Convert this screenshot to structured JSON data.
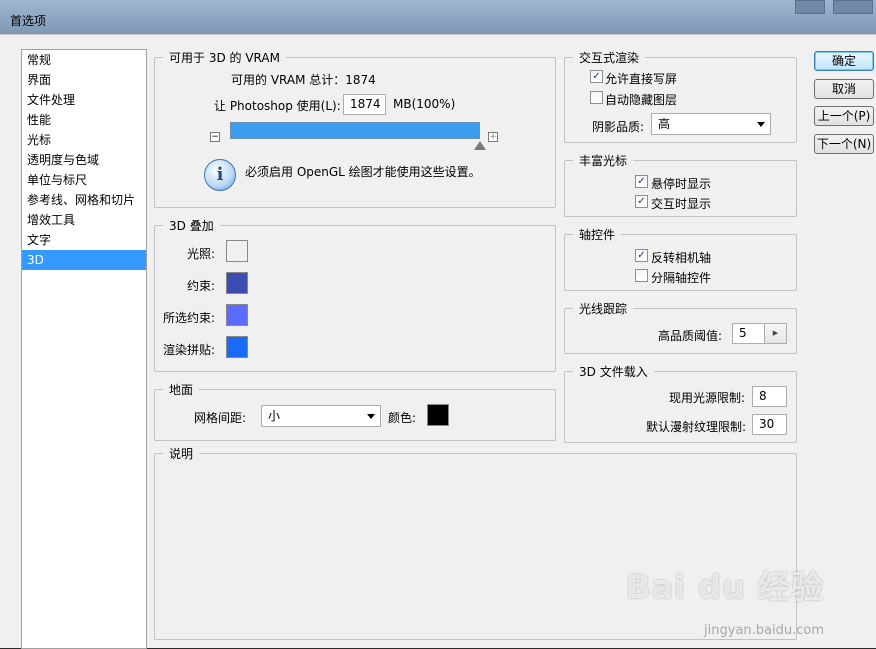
{
  "window": {
    "title": "首选项"
  },
  "sidebar": {
    "items": [
      {
        "label": "常规"
      },
      {
        "label": "界面"
      },
      {
        "label": "文件处理"
      },
      {
        "label": "性能"
      },
      {
        "label": "光标"
      },
      {
        "label": "透明度与色域"
      },
      {
        "label": "单位与标尺"
      },
      {
        "label": "参考线、网格和切片"
      },
      {
        "label": "增效工具"
      },
      {
        "label": "文字"
      },
      {
        "label": "3D"
      }
    ],
    "selected": "3D"
  },
  "vram": {
    "legend": "可用于 3D 的 VRAM",
    "total_text": "可用的 VRAM 总计：1874",
    "use_label": "让 Photoshop 使用(L):",
    "use_value": "1874",
    "unit_text": "MB(100%)",
    "slider_fraction": 1.0,
    "slider_min_icon": "−",
    "slider_max_icon": "+",
    "info_text": "必须启用 OpenGL 绘图才能使用这些设置。"
  },
  "overlay": {
    "legend": "3D 叠加",
    "rows": [
      {
        "label": "光照:",
        "color": "#f0f0f0"
      },
      {
        "label": "约束:",
        "color": "#3d4cb0"
      },
      {
        "label": "所选约束:",
        "color": "#5c6bff"
      },
      {
        "label": "渲染拼贴:",
        "color": "#1a6af5"
      }
    ]
  },
  "ground": {
    "legend": "地面",
    "grid_label": "网格间距:",
    "grid_value": "小",
    "color_label": "颜色:",
    "color": "#000000"
  },
  "description": {
    "legend": "说明"
  },
  "interactive": {
    "legend": "交互式渲染",
    "allow_direct_write": "允许直接写屏",
    "auto_hide_layers": "自动隐藏图层",
    "shadow_quality_label": "阴影品质:",
    "shadow_quality_value": "高"
  },
  "rich_cursor": {
    "legend": "丰富光标",
    "show_on_hover": "悬停时显示",
    "show_on_interact": "交互时显示"
  },
  "axis": {
    "legend": "轴控件",
    "invert_camera": "反转相机轴",
    "separate_axis": "分隔轴控件"
  },
  "raytrace": {
    "legend": "光线跟踪",
    "threshold_label": "高品质阈值:",
    "threshold_value": "5"
  },
  "file_load": {
    "legend": "3D 文件载入",
    "light_limit_label": "现用光源限制:",
    "light_limit_value": "8",
    "texture_limit_label": "默认漫射纹理限制:",
    "texture_limit_value": "30"
  },
  "buttons": {
    "ok": "确定",
    "cancel": "取消",
    "prev": "上一个(P)",
    "next": "下一个(N)"
  },
  "watermark": {
    "logo": "Bai du 经验",
    "url": "jingyan.baidu.com"
  }
}
